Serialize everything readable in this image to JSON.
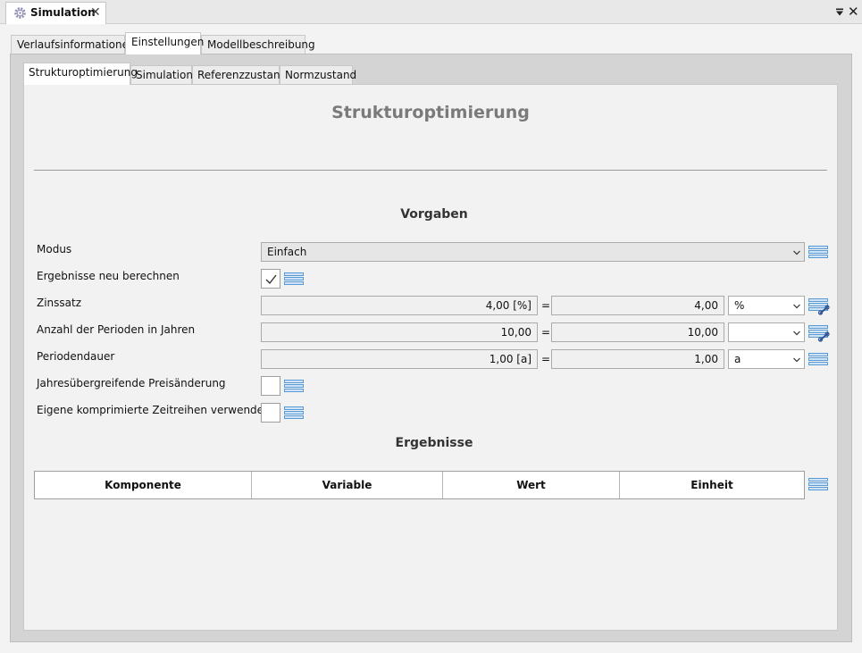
{
  "view": {
    "title": "Simulation",
    "icon": "gear-icon"
  },
  "outer_tabs": [
    "Verlaufsinformationen",
    "Einstellungen",
    "Modellbeschreibung"
  ],
  "inner_tabs": [
    "Strukturoptimierung",
    "Simulation",
    "Referenzzustand",
    "Normzustand"
  ],
  "page_title": "Strukturoptimierung",
  "section_vorgaben": "Vorgaben",
  "fields": {
    "modus": {
      "label": "Modus",
      "value": "Einfach"
    },
    "ergebnisse_neu": {
      "label": "Ergebnisse neu berechnen",
      "checked": true
    },
    "zinssatz": {
      "label": "Zinssatz",
      "left": "4,00 [%]",
      "right": "4,00",
      "unit": "%"
    },
    "perioden": {
      "label": "Anzahl der Perioden in Jahren",
      "left": "10,00",
      "right": "10,00",
      "unit": ""
    },
    "periodendauer": {
      "label": "Periodendauer",
      "left": "1,00 [a]",
      "right": "1,00",
      "unit": "a"
    },
    "preisaenderung": {
      "label": "Jahresübergreifende Preisänderung",
      "checked": false
    },
    "zeitreihen": {
      "label": "Eigene komprimierte Zeitreihen verwenden",
      "checked": false
    }
  },
  "equals": "=",
  "section_ergebnisse": "Ergebnisse",
  "results_table": {
    "columns": [
      "Komponente",
      "Variable",
      "Wert",
      "Einheit"
    ]
  },
  "colors": {
    "menu_icon": "#5b9bd5",
    "link_icon": "#2f5597"
  }
}
